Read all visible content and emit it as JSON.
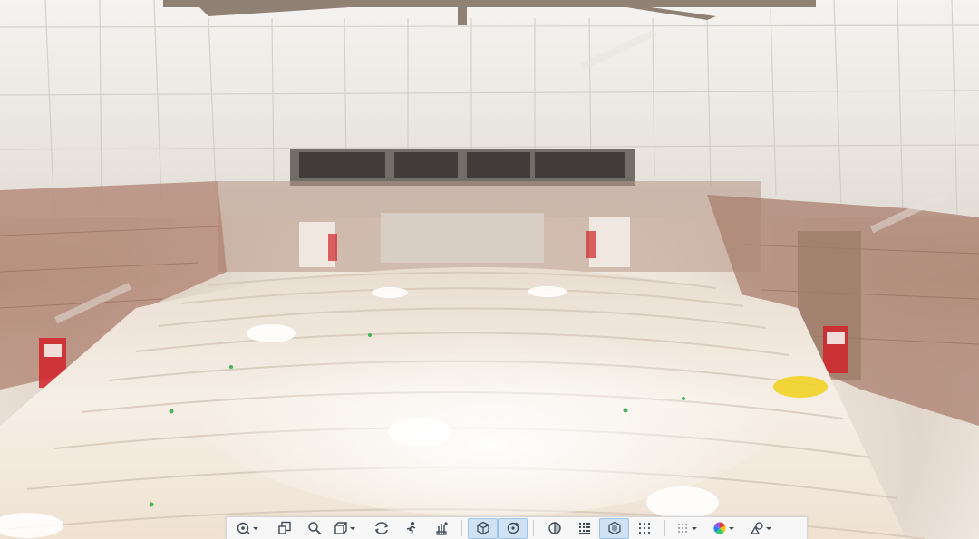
{
  "scene": {
    "wall_color": "#c39b86",
    "sign_color": "#d1232a",
    "marker_color": "#f1d11b",
    "point_marker_color": "#45b45a"
  },
  "toolbar": {
    "accent": "#cfe3f4",
    "icon_color": "#3f4a57",
    "buttons": [
      {
        "id": "orbit",
        "icon": "orbit-navigation-icon",
        "has_menu": true
      },
      {
        "id": "fit",
        "icon": "fit-view-icon",
        "has_menu": false
      },
      {
        "id": "zoom",
        "icon": "zoom-icon",
        "has_menu": false
      },
      {
        "id": "view-cube",
        "icon": "view-cube-icon",
        "has_menu": true
      },
      {
        "id": "rotate",
        "icon": "rotate-icon",
        "has_menu": false
      },
      {
        "id": "walk",
        "icon": "walk-icon",
        "has_menu": false
      },
      {
        "id": "pan",
        "icon": "pan-icon",
        "has_menu": false
      },
      {
        "id": "section-box",
        "icon": "section-box-icon",
        "active": true
      },
      {
        "id": "section-rotate",
        "icon": "section-rotate-icon",
        "active": true
      },
      {
        "id": "half-view",
        "icon": "half-circle-icon"
      },
      {
        "id": "points",
        "icon": "point-grid-icon"
      },
      {
        "id": "box-select",
        "icon": "hexagon-box-icon",
        "active": true
      },
      {
        "id": "dot-grid",
        "icon": "dot-grid-icon"
      },
      {
        "id": "density",
        "icon": "density-icon",
        "has_menu": true
      },
      {
        "id": "color-mode",
        "icon": "color-wheel-icon",
        "has_menu": true
      },
      {
        "id": "settings",
        "icon": "shapes-settings-icon",
        "has_menu": true
      }
    ]
  }
}
